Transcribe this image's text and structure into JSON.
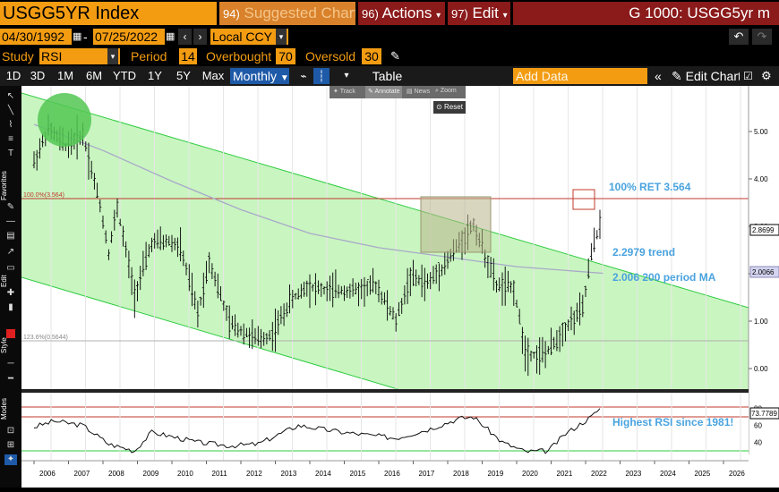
{
  "header": {
    "ticker": "USGG5YR Index",
    "suggested_num": "94)",
    "suggested_label": "Suggested Charts",
    "actions_num": "96)",
    "actions_label": "Actions",
    "edit_num": "97)",
    "edit_label": "Edit",
    "right_title": "G 1000: USGG5yr m"
  },
  "range": {
    "start_date": "04/30/1992",
    "end_date": "07/25/2022",
    "currency": "Local CCY"
  },
  "study": {
    "label": "Study",
    "name": "RSI",
    "period_label": "Period",
    "period_value": "14",
    "overbought_label": "Overbought",
    "overbought_value": "70",
    "oversold_label": "Oversold",
    "oversold_value": "30"
  },
  "timebar": {
    "periods": [
      "1D",
      "3D",
      "1M",
      "6M",
      "YTD",
      "1Y",
      "5Y",
      "Max"
    ],
    "frequency": "Monthly",
    "table_label": "Table",
    "add_data_placeholder": "Add Data",
    "edit_chart_label": "Edit Chart"
  },
  "mini_toolbar": {
    "track": "Track",
    "annotate": "Annotate",
    "news": "News",
    "zoom": "Zoom",
    "reset": "Reset"
  },
  "sidebar_labels": {
    "favorites": "Favorites",
    "edit": "Edit",
    "style": "Style",
    "modes": "Modes"
  },
  "annotations": {
    "ret_label": "100% RET 3.564",
    "trend_label": "2.2979  trend",
    "ma_label": "2.006 200 period MA",
    "rsi_note": "Highest RSI since 1981!",
    "fib_100": "100.0%(3.564)",
    "fib_123": "123.6%(0.5644)"
  },
  "price_axis": {
    "ticks": [
      "5.00",
      "4.00",
      "3.00",
      "2.00",
      "1.00",
      "0.00"
    ],
    "last_price": "2.8699",
    "ma_value": "2.0066"
  },
  "rsi_axis": {
    "ticks": [
      "80",
      "60",
      "40"
    ],
    "last_value": "73.7789"
  },
  "x_axis": {
    "years": [
      "2006",
      "2007",
      "2008",
      "2009",
      "2010",
      "2011",
      "2012",
      "2013",
      "2014",
      "2015",
      "2016",
      "2017",
      "2018",
      "2019",
      "2020",
      "2021",
      "2022",
      "2023",
      "2024",
      "2025",
      "2026"
    ]
  },
  "colors": {
    "bloomberg_orange": "#f39c12",
    "header_red": "#8b1a1a",
    "channel_green": "#c8f5c0",
    "annotation_blue": "#4aa3df",
    "ret_line_red": "#c0392b"
  },
  "chart_data": {
    "type": "line",
    "title": "",
    "price_series_approx": [
      {
        "date": "2006-01",
        "value": 4.35
      },
      {
        "date": "2006-06",
        "value": 5.05
      },
      {
        "date": "2006-12",
        "value": 4.7
      },
      {
        "date": "2007-06",
        "value": 4.95
      },
      {
        "date": "2007-12",
        "value": 3.45
      },
      {
        "date": "2008-03",
        "value": 2.45
      },
      {
        "date": "2008-06",
        "value": 3.4
      },
      {
        "date": "2008-12",
        "value": 1.55
      },
      {
        "date": "2009-06",
        "value": 2.65
      },
      {
        "date": "2009-12",
        "value": 2.68
      },
      {
        "date": "2010-04",
        "value": 2.55
      },
      {
        "date": "2010-10",
        "value": 1.15
      },
      {
        "date": "2011-02",
        "value": 2.3
      },
      {
        "date": "2011-09",
        "value": 0.95
      },
      {
        "date": "2012-07",
        "value": 0.6
      },
      {
        "date": "2012-12",
        "value": 0.72
      },
      {
        "date": "2013-06",
        "value": 1.4
      },
      {
        "date": "2013-12",
        "value": 1.75
      },
      {
        "date": "2014-06",
        "value": 1.65
      },
      {
        "date": "2014-12",
        "value": 1.65
      },
      {
        "date": "2015-06",
        "value": 1.65
      },
      {
        "date": "2015-12",
        "value": 1.76
      },
      {
        "date": "2016-07",
        "value": 1.0
      },
      {
        "date": "2016-12",
        "value": 1.93
      },
      {
        "date": "2017-06",
        "value": 1.8
      },
      {
        "date": "2017-12",
        "value": 2.2
      },
      {
        "date": "2018-10",
        "value": 3.05
      },
      {
        "date": "2019-06",
        "value": 1.75
      },
      {
        "date": "2019-12",
        "value": 1.7
      },
      {
        "date": "2020-04",
        "value": 0.37
      },
      {
        "date": "2020-08",
        "value": 0.27
      },
      {
        "date": "2020-12",
        "value": 0.36
      },
      {
        "date": "2021-06",
        "value": 0.87
      },
      {
        "date": "2021-12",
        "value": 1.26
      },
      {
        "date": "2022-03",
        "value": 2.42
      },
      {
        "date": "2022-06",
        "value": 3.04
      },
      {
        "date": "2022-07",
        "value": 2.87
      }
    ],
    "moving_average_200_approx": [
      {
        "date": "2006-01",
        "value": 5.15
      },
      {
        "date": "2008-01",
        "value": 4.6
      },
      {
        "date": "2010-01",
        "value": 3.95
      },
      {
        "date": "2012-01",
        "value": 3.35
      },
      {
        "date": "2014-01",
        "value": 2.85
      },
      {
        "date": "2016-01",
        "value": 2.55
      },
      {
        "date": "2018-01",
        "value": 2.35
      },
      {
        "date": "2020-01",
        "value": 2.15
      },
      {
        "date": "2022-07",
        "value": 2.01
      }
    ],
    "rsi_series_approx": [
      {
        "date": "2006-01",
        "value": 58
      },
      {
        "date": "2006-08",
        "value": 65
      },
      {
        "date": "2007-06",
        "value": 60
      },
      {
        "date": "2008-03",
        "value": 38
      },
      {
        "date": "2008-12",
        "value": 30
      },
      {
        "date": "2009-06",
        "value": 52
      },
      {
        "date": "2010-10",
        "value": 40
      },
      {
        "date": "2011-09",
        "value": 36
      },
      {
        "date": "2012-07",
        "value": 38
      },
      {
        "date": "2013-09",
        "value": 60
      },
      {
        "date": "2014-12",
        "value": 52
      },
      {
        "date": "2016-07",
        "value": 45
      },
      {
        "date": "2017-06",
        "value": 55
      },
      {
        "date": "2018-05",
        "value": 68
      },
      {
        "date": "2018-10",
        "value": 70
      },
      {
        "date": "2019-08",
        "value": 40
      },
      {
        "date": "2020-04",
        "value": 29
      },
      {
        "date": "2020-12",
        "value": 30
      },
      {
        "date": "2021-06",
        "value": 50
      },
      {
        "date": "2022-03",
        "value": 70
      },
      {
        "date": "2022-06",
        "value": 80
      },
      {
        "date": "2022-07",
        "value": 73.78
      }
    ],
    "ylim": [
      -0.4,
      5.8
    ],
    "rsi_ylim": [
      25,
      90
    ]
  }
}
